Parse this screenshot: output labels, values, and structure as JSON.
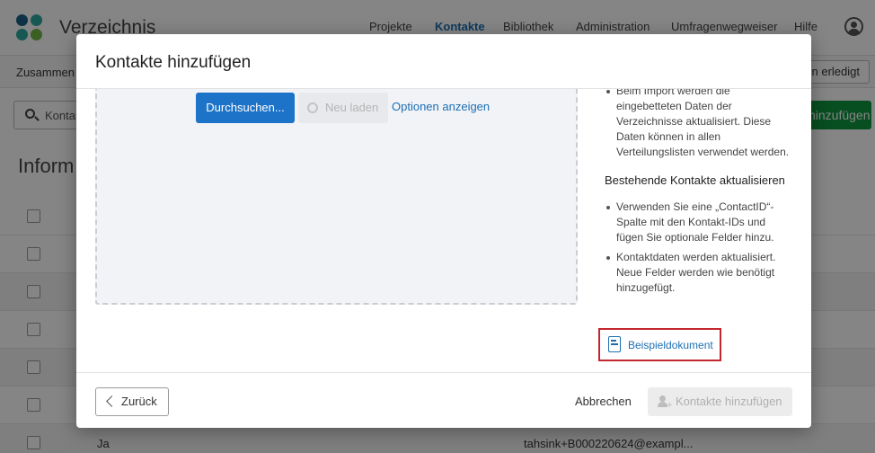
{
  "app": {
    "title": "Verzeichnis",
    "nav": [
      "Projekte",
      "Kontakte",
      "Bibliothek",
      "Administration",
      "Umfragenwegweiser",
      "Hilfe"
    ],
    "active_nav": "Kontakte",
    "subbar_label": "Zusammen",
    "subbar_right": "pen erledigt",
    "search_placeholder": "Kontakt",
    "add_button": "hinzufügen",
    "section_title": "Inform",
    "rows": [
      {
        "col1": "",
        "col2": ""
      },
      {
        "col1": "",
        "col2": ""
      },
      {
        "col1": "",
        "col2": ""
      },
      {
        "col1": "",
        "col2": ""
      },
      {
        "col1": "",
        "col2": ""
      },
      {
        "col1": "",
        "col2": ""
      },
      {
        "col1": "Ja",
        "col2": "tahsink+B000220624@exampl..."
      }
    ]
  },
  "modal": {
    "title": "Kontakte hinzufügen",
    "browse_button": "Durchsuchen...",
    "reload_button": "Neu laden",
    "options_link": "Optionen anzeigen",
    "import_bullets": [
      "Beim Import werden die eingebetteten Daten der Verzeichnisse aktualisiert. Diese Daten können in allen Verteilungslisten verwendet werden."
    ],
    "update_heading": "Bestehende Kontakte aktualisieren",
    "update_bullets": [
      "Verwenden Sie eine „ContactID“-Spalte mit den Kontakt-IDs und fügen Sie optionale Felder hinzu.",
      "Kontaktdaten werden aktualisiert. Neue Felder werden wie benötigt hinzugefügt."
    ],
    "sample_link": "Beispieldokument",
    "back_button": "Zurück",
    "cancel_button": "Abbrechen",
    "submit_button": "Kontakte hinzufügen"
  },
  "colors": {
    "accent_blue": "#1d73c8",
    "link_blue": "#1d6fb3",
    "green": "#0f9640",
    "highlight_red": "#c4262e"
  }
}
